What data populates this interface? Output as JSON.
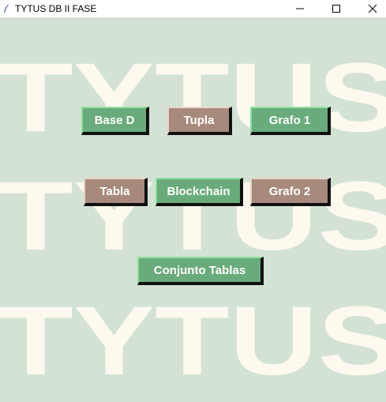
{
  "window": {
    "title": "TYTUS DB II FASE"
  },
  "background": {
    "watermark_lines": [
      "TYTUS",
      "TYTUS",
      "TYTUS"
    ]
  },
  "buttons": {
    "base_d": "Base D",
    "tupla": "Tupla",
    "grafo_1": "Grafo 1",
    "tabla": "Tabla",
    "blockchain": "Blockchain",
    "grafo_2": "Grafo 2",
    "conjunto_tablas": "Conjunto Tablas"
  },
  "colors": {
    "background": "#d3e2d3",
    "green_button": "#6aab7c",
    "brown_button": "#a88a7c",
    "watermark": "#fdf9ef"
  }
}
